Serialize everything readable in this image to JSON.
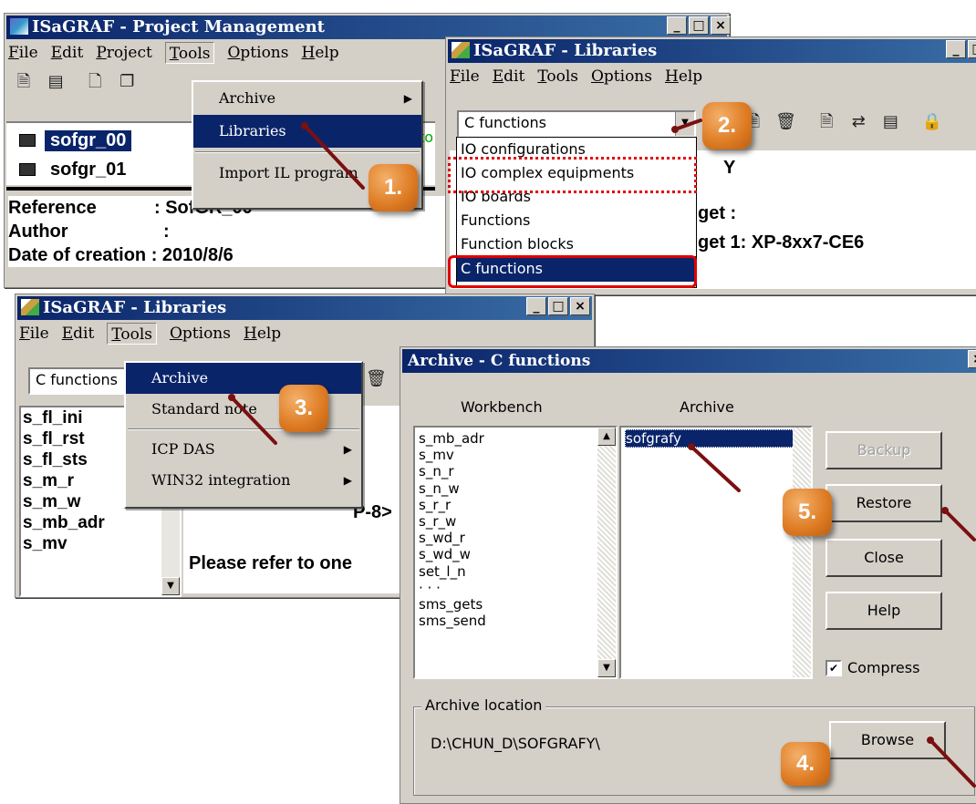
{
  "colors": {
    "titlebar_start": "#0a246a",
    "titlebar_end": "#3a6ea5",
    "dialog_face": "#d4d0c8",
    "badge_orange": "#dd7a22",
    "highlight_red": "#e00000",
    "pointer_dark_red": "#7a1010"
  },
  "pm_window": {
    "title": "ISaGRAF - Project Management",
    "menus": [
      "File",
      "Edit",
      "Project",
      "Tools",
      "Options",
      "Help"
    ],
    "toolbar_icons": [
      "document-icon",
      "grid-icon",
      "new-page-icon",
      "copy-icon"
    ],
    "projects": [
      "sofgr_00",
      "sofgr_01"
    ],
    "partial_text": "to",
    "details": {
      "reference_label": "Reference",
      "reference_value": ": SofGR_00",
      "author_label": "Author",
      "author_value": ":",
      "date_label": "Date of creation : 2010/8/6"
    },
    "tools_menu": {
      "items": [
        "Archive",
        "Libraries",
        "Import IL program"
      ]
    }
  },
  "lib_window_top": {
    "title": "ISaGRAF - Libraries",
    "menus": [
      "File",
      "Edit",
      "Tools",
      "Options",
      "Help"
    ],
    "combo_value": "C functions",
    "dropdown_items": [
      "IO configurations",
      "IO complex equipments",
      "IO boards",
      "Functions",
      "Function blocks",
      "C functions"
    ],
    "bg_text": {
      "letter": "Y",
      "target_label": "get :",
      "target_value": "get 1:  XP-8xx7-CE6"
    }
  },
  "lib_window_bottom": {
    "title": "ISaGRAF - Libraries",
    "menus": [
      "File",
      "Edit",
      "Tools",
      "Options",
      "Help"
    ],
    "combo_value": "C functions",
    "list_items": [
      "s_fl_ini",
      "s_fl_rst",
      "s_fl_sts",
      "s_m_r",
      "s_m_w",
      "s_mb_adr",
      "s_mv"
    ],
    "bg_text": {
      "partial": "P-8>",
      "note": "Please refer to one"
    },
    "tools_menu": {
      "items": [
        "Archive",
        "Standard note",
        "ICP DAS",
        "WIN32 integration"
      ]
    }
  },
  "archive_dialog": {
    "title": "Archive - C functions",
    "workbench_label": "Workbench",
    "archive_label": "Archive",
    "workbench_items": [
      "s_mb_adr",
      "s_mv",
      "s_n_r",
      "s_n_w",
      "s_r_r",
      "s_r_w",
      "s_wd_r",
      "s_wd_w",
      "set_l_n",
      "·  ·  ·",
      "sms_gets",
      "sms_send"
    ],
    "archive_items": [
      "sofgrafy"
    ],
    "buttons": {
      "backup": "Backup",
      "restore": "Restore",
      "close": "Close",
      "help": "Help",
      "browse": "Browse"
    },
    "compress_label": "Compress",
    "compress_checked": true,
    "location_label": "Archive location",
    "location_value": "D:\\CHUN_D\\SOFGRAFY\\"
  },
  "steps": [
    "1.",
    "2.",
    "3.",
    "4.",
    "5."
  ]
}
